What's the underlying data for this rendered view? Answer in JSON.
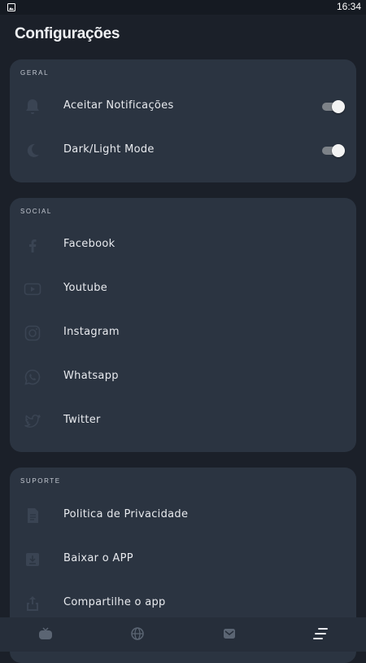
{
  "status_bar": {
    "time": "16:34"
  },
  "page": {
    "title": "Configurações"
  },
  "sections": {
    "geral": {
      "label": "GERAL",
      "items": [
        {
          "label": "Aceitar Notificações",
          "icon": "bell-icon",
          "toggle": true
        },
        {
          "label": "Dark/Light Mode",
          "icon": "moon-icon",
          "toggle": true
        }
      ]
    },
    "social": {
      "label": "SOCIAL",
      "items": [
        {
          "label": "Facebook",
          "icon": "facebook-icon"
        },
        {
          "label": "Youtube",
          "icon": "youtube-icon"
        },
        {
          "label": "Instagram",
          "icon": "instagram-icon"
        },
        {
          "label": "Whatsapp",
          "icon": "whatsapp-icon"
        },
        {
          "label": "Twitter",
          "icon": "twitter-icon"
        }
      ]
    },
    "suporte": {
      "label": "SUPORTE",
      "items": [
        {
          "label": "Politica de Privacidade",
          "icon": "document-icon"
        },
        {
          "label": "Baixar o APP",
          "icon": "download-icon"
        },
        {
          "label": "Compartilhe o app",
          "icon": "share-icon"
        }
      ]
    }
  },
  "bottom_nav": [
    {
      "icon": "tv-icon"
    },
    {
      "icon": "globe-icon"
    },
    {
      "icon": "mail-icon"
    },
    {
      "icon": "menu-icon",
      "active": true
    }
  ],
  "colors": {
    "background": "#1b2029",
    "card": "#2b3441",
    "icon_muted": "#3a4453",
    "toggle_track": "#7d8288",
    "toggle_knob": "#f3f3f3"
  }
}
